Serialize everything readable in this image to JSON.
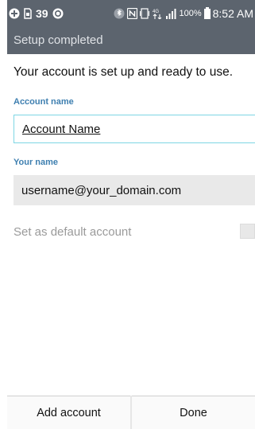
{
  "status_bar": {
    "notification_count": "39",
    "battery_percent": "100%",
    "time": "8:52 AM",
    "icons": [
      "add-icon",
      "sim-icon",
      "sync-icon",
      "bluetooth-icon",
      "nfc-icon",
      "vibrate-icon",
      "data-arrows-icon",
      "signal-icon",
      "battery-icon"
    ]
  },
  "title": "Setup completed",
  "intro_text": "Your account is set up and ready to use.",
  "account_name": {
    "label": "Account name",
    "value": "Account Name"
  },
  "your_name": {
    "label": "Your name",
    "value": "username@your_domain.com"
  },
  "default_account": {
    "label": "Set as default account",
    "checked": false
  },
  "buttons": {
    "add_account": "Add account",
    "done": "Done"
  },
  "colors": {
    "bar": "#5c646e",
    "label_blue": "#3e7fb0",
    "field_border": "#7ed6e4"
  }
}
